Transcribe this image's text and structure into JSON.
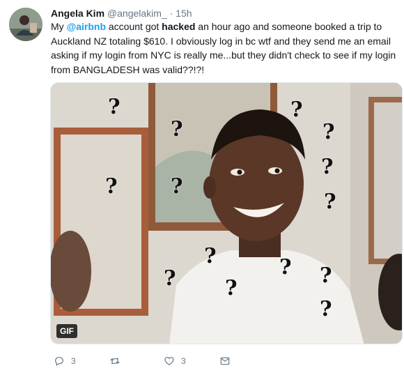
{
  "author": {
    "name": "Angela Kim",
    "handle": "@angelakim_",
    "separator": "·",
    "time": "15h"
  },
  "tweet": {
    "segments": [
      {
        "text": "My ",
        "kind": "plain"
      },
      {
        "text": "@airbnb",
        "kind": "mention"
      },
      {
        "text": " account got ",
        "kind": "plain"
      },
      {
        "text": "hacked",
        "kind": "bold"
      },
      {
        "text": " an hour ago and someone booked a trip to Auckland NZ totaling $610. I obviously log in bc wtf and they send me an email asking if my login from NYC is really me...but they didn't check to see if my login from BANGLADESH was valid??!?!",
        "kind": "plain"
      }
    ]
  },
  "media": {
    "badge": "GIF",
    "overlay_marks": [
      "?",
      "?",
      "?",
      "?",
      "?",
      "?",
      "?",
      "?",
      "?",
      "?",
      "?",
      "?",
      "?",
      "?"
    ]
  },
  "actions": {
    "reply_count": "3",
    "retweet_count": "",
    "like_count": "3",
    "icons": [
      "reply-icon",
      "retweet-icon",
      "like-icon",
      "direct-message-icon"
    ]
  },
  "colors": {
    "mention": "#1da1f2",
    "secondary_text": "#657786",
    "primary_text": "#14171a"
  }
}
